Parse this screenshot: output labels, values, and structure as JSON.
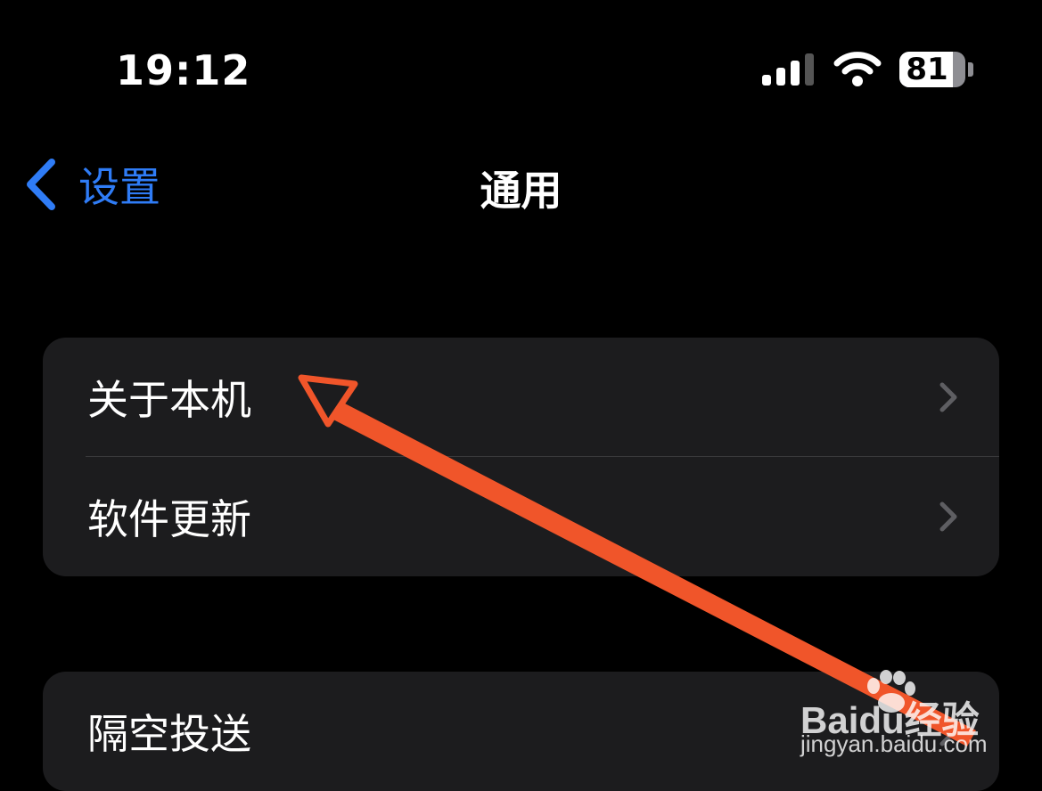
{
  "status_bar": {
    "time": "19:12",
    "battery": "81",
    "battery_level": 0.81,
    "signal_bars_active": 3,
    "signal_bars_total": 4,
    "icons": [
      "signal-icon",
      "wifi-icon",
      "battery-icon"
    ]
  },
  "nav": {
    "back_label": "设置",
    "title": "通用",
    "accent_color": "#2f7cf6"
  },
  "groups": [
    {
      "rows": [
        {
          "label": "关于本机"
        },
        {
          "label": "软件更新"
        }
      ]
    },
    {
      "rows": [
        {
          "label": "隔空投送"
        }
      ]
    }
  ],
  "annotation": {
    "type": "arrow",
    "color": "#f0552a"
  },
  "watermark": {
    "logo": "Baidu经验",
    "url": "jingyan.baidu.com"
  }
}
